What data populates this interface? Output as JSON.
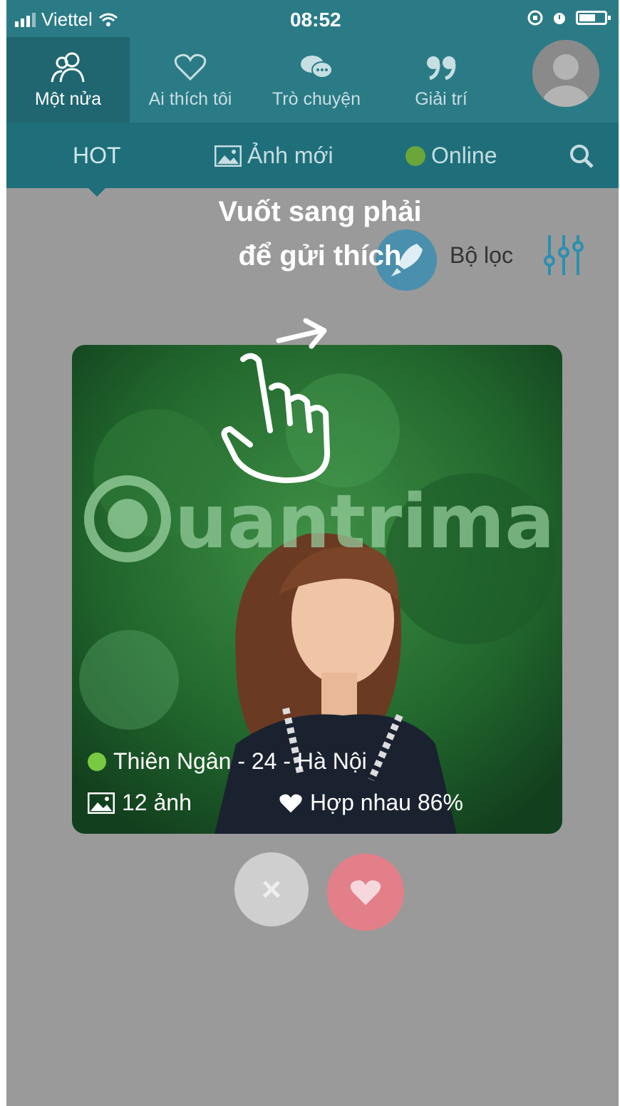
{
  "status_bar": {
    "carrier": "Viettel",
    "time": "08:52"
  },
  "top_nav": {
    "items": [
      {
        "label": "Một nửa",
        "icon": "people-icon",
        "active": true
      },
      {
        "label": "Ai thích tôi",
        "icon": "heart-outline-icon",
        "active": false
      },
      {
        "label": "Trò chuyện",
        "icon": "chat-bubbles-icon",
        "active": false
      },
      {
        "label": "Giải trí",
        "icon": "quote-icon",
        "active": false
      }
    ],
    "avatar": "avatar"
  },
  "sub_nav": {
    "hot": "HOT",
    "new_photos": "Ảnh mới",
    "online": "Online",
    "search_icon": "search-icon"
  },
  "hint": {
    "line1": "Vuốt sang phải",
    "line2": "để gửi thích"
  },
  "filter": {
    "label": "Bộ lọc"
  },
  "profile": {
    "name_line": "Thiên Ngân -  24 - Hà Nội",
    "photos": "12 ảnh",
    "match": "Hợp nhau 86%"
  },
  "watermark": "Quantrimang",
  "colors": {
    "header": "#2b7b86",
    "subnav": "#1f6f7b",
    "background": "#9a9a9a",
    "online": "#7ac943",
    "like": "#e37f89"
  }
}
